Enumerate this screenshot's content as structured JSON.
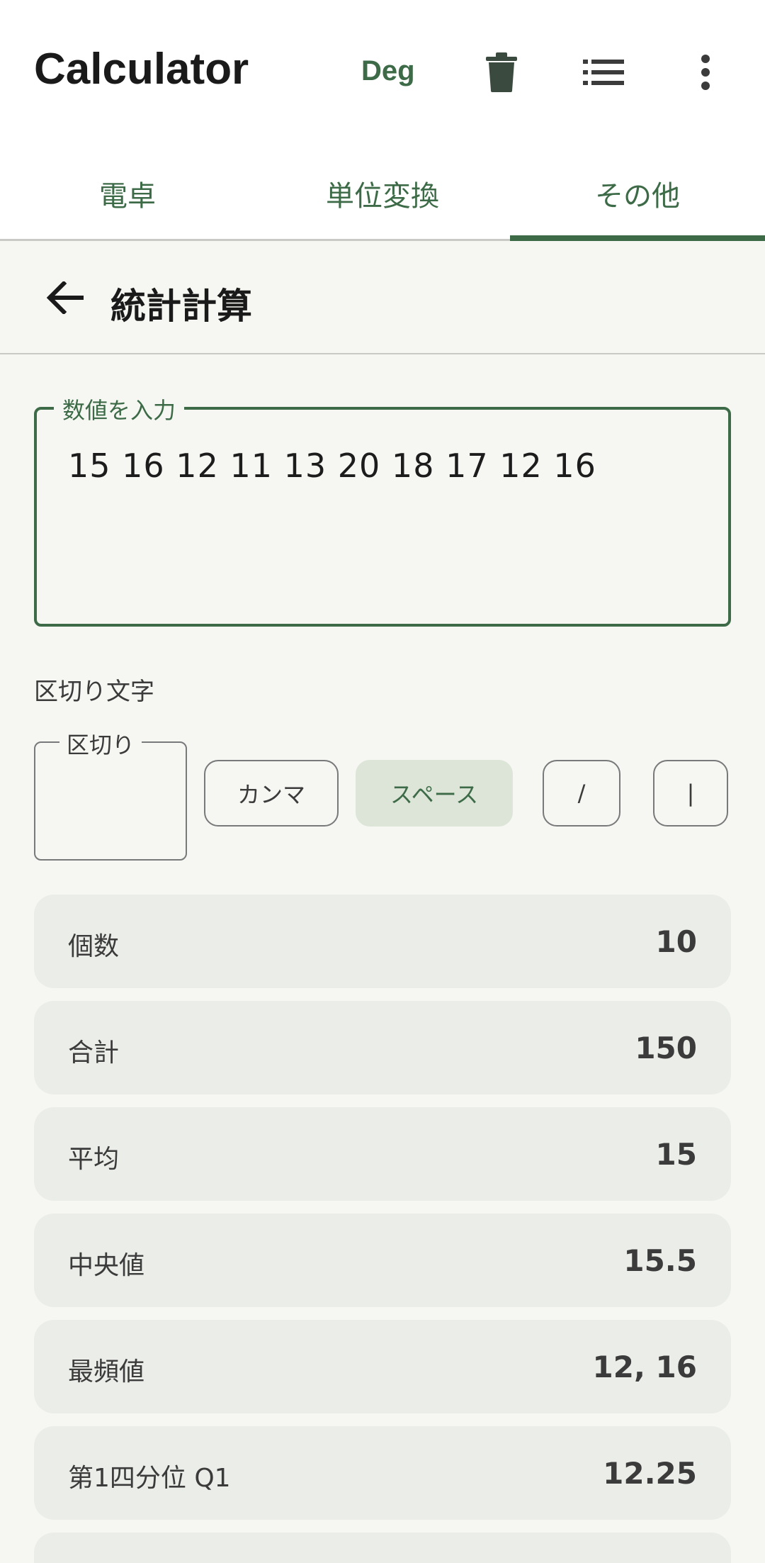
{
  "appbar": {
    "title": "Calculator",
    "angle_mode": "Deg",
    "icons": [
      "trash-icon",
      "list-icon",
      "more-vert-icon"
    ]
  },
  "tabs": [
    {
      "label": "電卓",
      "selected": false
    },
    {
      "label": "単位変換",
      "selected": false
    },
    {
      "label": "その他",
      "selected": true
    }
  ],
  "subheader": {
    "title": "統計計算"
  },
  "input": {
    "label": "数値を入力",
    "value": "15 16 12 11 13 20 18 17 12 16"
  },
  "separator": {
    "title": "区切り文字",
    "field_label": "区切り",
    "field_value": "",
    "chips": [
      {
        "label": "カンマ",
        "selected": false
      },
      {
        "label": "スペース",
        "selected": true
      },
      {
        "label": "/",
        "selected": false
      },
      {
        "label": "|",
        "selected": false
      }
    ]
  },
  "stats": [
    {
      "label": "個数",
      "value": "10"
    },
    {
      "label": "合計",
      "value": "150"
    },
    {
      "label": "平均",
      "value": "15"
    },
    {
      "label": "中央値",
      "value": "15.5"
    },
    {
      "label": "最頻値",
      "value": "12, 16"
    },
    {
      "label": "第1四分位 Q1",
      "value": "12.25"
    },
    {
      "label": "",
      "value": ""
    }
  ],
  "colors": {
    "accent": "#3d6b47",
    "background": "#f6f7f2",
    "row": "#ebeee8",
    "chip_selected": "#dde5d9"
  }
}
